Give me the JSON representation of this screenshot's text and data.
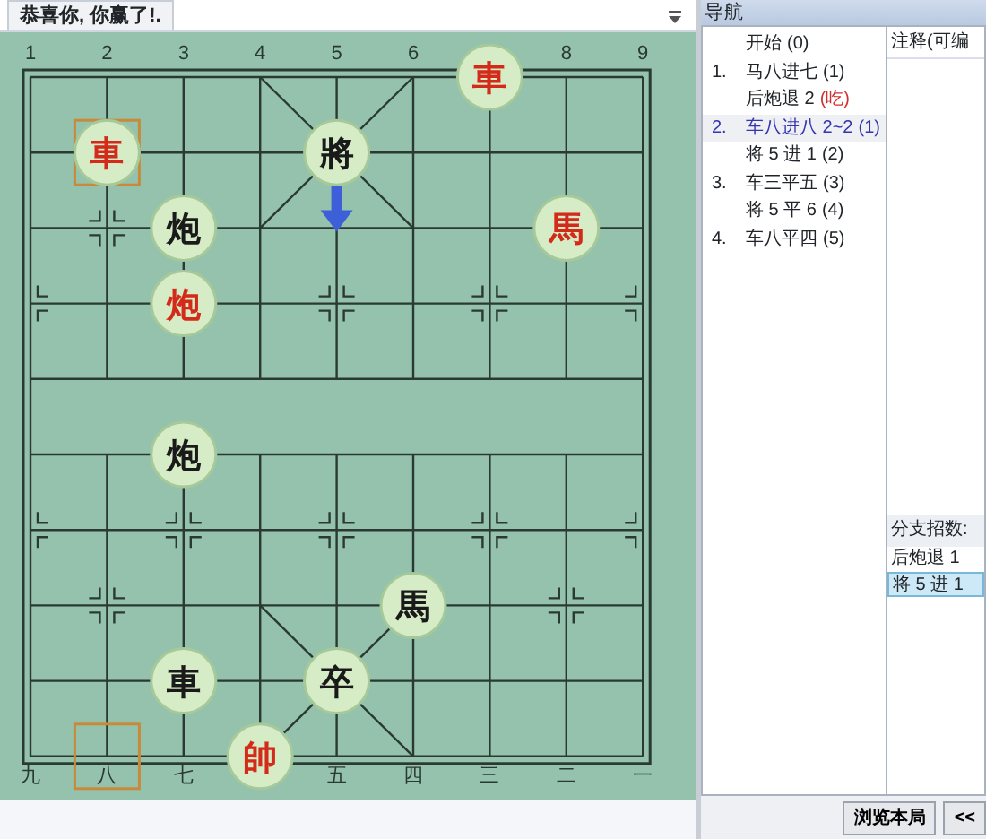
{
  "board": {
    "title": "恭喜你, 你赢了!.",
    "file_labels_top": [
      {
        "text": "1"
      },
      {
        "text": "2"
      },
      {
        "text": "3"
      },
      {
        "text": "4"
      },
      {
        "text": "5"
      },
      {
        "text": "6"
      },
      {
        "text": "8"
      },
      {
        "text": "9"
      }
    ],
    "file_labels_bottom": [
      {
        "text": "九"
      },
      {
        "text": "八"
      },
      {
        "text": "七"
      },
      {
        "text": "五"
      },
      {
        "text": "四"
      },
      {
        "text": "三"
      },
      {
        "text": "二"
      },
      {
        "text": "一"
      }
    ],
    "pieces": [
      {
        "char": "車",
        "kind": "red"
      },
      {
        "char": "車",
        "kind": "red"
      },
      {
        "char": "將",
        "kind": "black"
      },
      {
        "char": "炮",
        "kind": "black"
      },
      {
        "char": "馬",
        "kind": "red"
      },
      {
        "char": "炮",
        "kind": "red"
      },
      {
        "char": "炮",
        "kind": "black"
      },
      {
        "char": "馬",
        "kind": "black"
      },
      {
        "char": "車",
        "kind": "black"
      },
      {
        "char": "卒",
        "kind": "black"
      },
      {
        "char": "帥",
        "kind": "red"
      }
    ]
  },
  "navigation": {
    "title": "导航",
    "moves": [
      {
        "text": "开始",
        "suffix": "(0)",
        "capture": false,
        "selected": false
      },
      {
        "number": "1.",
        "text": "马八进七",
        "suffix": "(1)",
        "capture": false,
        "selected": false
      },
      {
        "text": "后炮退 2",
        "suffix": "(吃)",
        "capture": true,
        "selected": false
      },
      {
        "number": "2.",
        "text": "车八进八 2~2",
        "suffix": "(1)",
        "capture": false,
        "selected": true
      },
      {
        "text": "将 5 进 1",
        "suffix": "(2)",
        "capture": false,
        "selected": false
      },
      {
        "number": "3.",
        "text": "车三平五",
        "suffix": "(3)",
        "capture": false,
        "selected": false
      },
      {
        "text": "将 5 平 6",
        "suffix": "(4)",
        "capture": false,
        "selected": false
      },
      {
        "number": "4.",
        "text": "车八平四",
        "suffix": "(5)",
        "capture": false,
        "selected": false
      }
    ]
  },
  "annotation": {
    "title": "注释(可编"
  },
  "branches": {
    "title": "分支招数:",
    "items": [
      {
        "text": "后炮退 1",
        "selected": false
      },
      {
        "text": "将 5 进 1",
        "selected": true
      }
    ]
  },
  "buttons": [
    "浏览本局",
    "<<"
  ]
}
